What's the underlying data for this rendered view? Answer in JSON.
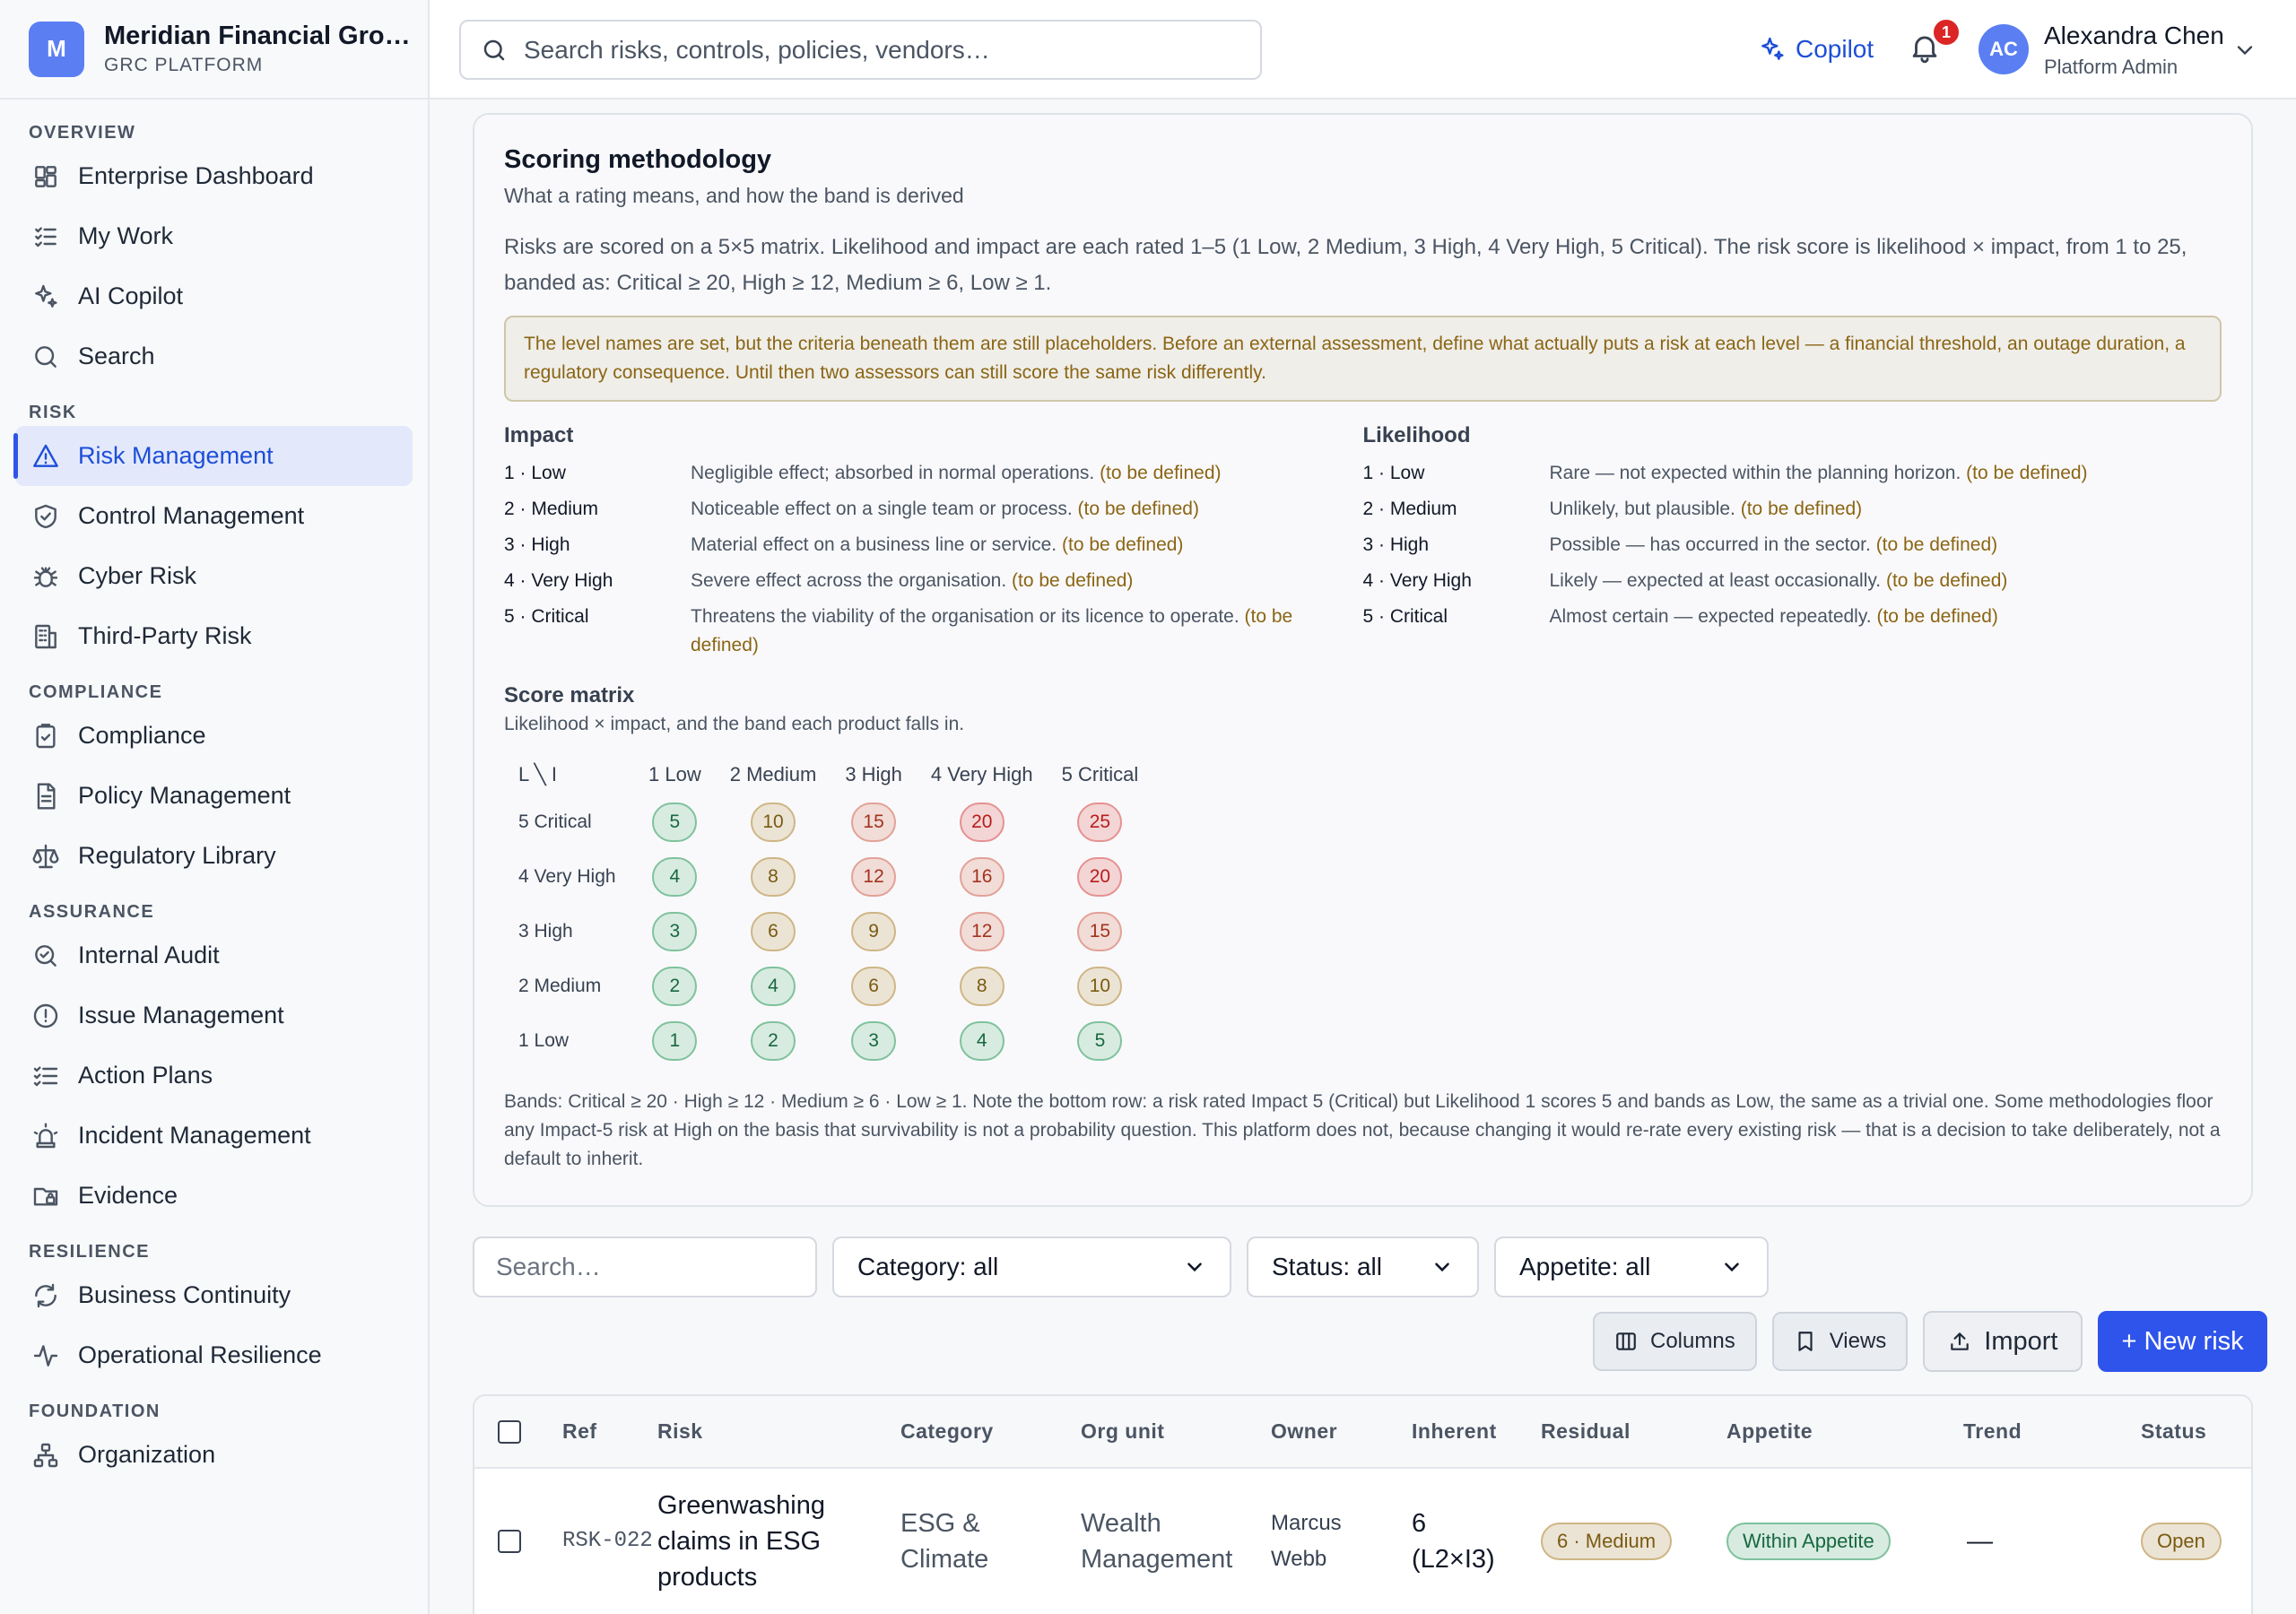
{
  "brand": {
    "logo": "M",
    "name": "Meridian Financial Gro…",
    "subtitle": "GRC PLATFORM"
  },
  "sidebar": {
    "sections": [
      {
        "title": "OVERVIEW",
        "items": [
          {
            "label": "Enterprise Dashboard",
            "icon": "dashboard-icon"
          },
          {
            "label": "My Work",
            "icon": "checklist-icon"
          },
          {
            "label": "AI Copilot",
            "icon": "sparkles-icon"
          },
          {
            "label": "Search",
            "icon": "search-icon"
          }
        ]
      },
      {
        "title": "RISK",
        "items": [
          {
            "label": "Risk Management",
            "icon": "warning-triangle-icon",
            "active": true
          },
          {
            "label": "Control Management",
            "icon": "shield-check-icon"
          },
          {
            "label": "Cyber Risk",
            "icon": "bug-icon"
          },
          {
            "label": "Third-Party Risk",
            "icon": "building-icon"
          }
        ]
      },
      {
        "title": "COMPLIANCE",
        "items": [
          {
            "label": "Compliance",
            "icon": "clipboard-check-icon"
          },
          {
            "label": "Policy Management",
            "icon": "document-icon"
          },
          {
            "label": "Regulatory Library",
            "icon": "scales-icon"
          }
        ]
      },
      {
        "title": "ASSURANCE",
        "items": [
          {
            "label": "Internal Audit",
            "icon": "magnify-check-icon"
          },
          {
            "label": "Issue Management",
            "icon": "alert-circle-icon"
          },
          {
            "label": "Action Plans",
            "icon": "list-check-icon"
          },
          {
            "label": "Incident Management",
            "icon": "siren-icon"
          },
          {
            "label": "Evidence",
            "icon": "folder-lock-icon"
          }
        ]
      },
      {
        "title": "RESILIENCE",
        "items": [
          {
            "label": "Business Continuity",
            "icon": "refresh-icon"
          },
          {
            "label": "Operational Resilience",
            "icon": "activity-icon"
          }
        ]
      },
      {
        "title": "FOUNDATION",
        "items": [
          {
            "label": "Organization",
            "icon": "org-chart-icon"
          }
        ]
      }
    ]
  },
  "topbar": {
    "search_placeholder": "Search risks, controls, policies, vendors…",
    "copilot_label": "Copilot",
    "notification_count": "1",
    "user": {
      "initials": "AC",
      "name": "Alexandra Chen",
      "role": "Platform Admin"
    }
  },
  "methodology": {
    "title": "Scoring methodology",
    "subtitle": "What a rating means, and how the band is derived",
    "body": "Risks are scored on a 5×5 matrix. Likelihood and impact are each rated 1–5 (1 Low, 2 Medium, 3 High, 4 Very High, 5 Critical). The risk score is likelihood × impact, from 1 to 25, banded as: Critical ≥ 20, High ≥ 12, Medium ≥ 6, Low ≥ 1.",
    "notice": "The level names are set, but the criteria beneath them are still placeholders. Before an external assessment, define what actually puts a risk at each level — a financial threshold, an outage duration, a regulatory consequence. Until then two assessors can still score the same risk differently.",
    "tbd_label": "(to be defined)",
    "impact": {
      "title": "Impact",
      "levels": [
        {
          "key": "1 · Low",
          "desc": "Negligible effect; absorbed in normal operations."
        },
        {
          "key": "2 · Medium",
          "desc": "Noticeable effect on a single team or process."
        },
        {
          "key": "3 · High",
          "desc": "Material effect on a business line or service."
        },
        {
          "key": "4 · Very High",
          "desc": "Severe effect across the organisation."
        },
        {
          "key": "5 · Critical",
          "desc": "Threatens the viability of the organisation or its licence to operate."
        }
      ]
    },
    "likelihood": {
      "title": "Likelihood",
      "levels": [
        {
          "key": "1 · Low",
          "desc": "Rare — not expected within the planning horizon."
        },
        {
          "key": "2 · Medium",
          "desc": "Unlikely, but plausible."
        },
        {
          "key": "3 · High",
          "desc": "Possible — has occurred in the sector."
        },
        {
          "key": "4 · Very High",
          "desc": "Likely — expected at least occasionally."
        },
        {
          "key": "5 · Critical",
          "desc": "Almost certain — expected repeatedly."
        }
      ]
    },
    "matrix": {
      "title": "Score matrix",
      "subtitle": "Likelihood × impact, and the band each product falls in.",
      "corner": "L ╲ I",
      "columns": [
        "1 Low",
        "2 Medium",
        "3 High",
        "4 Very High",
        "5 Critical"
      ],
      "rows": [
        {
          "label": "5 Critical",
          "values": [
            5,
            10,
            15,
            20,
            25
          ]
        },
        {
          "label": "4 Very High",
          "values": [
            4,
            8,
            12,
            16,
            20
          ]
        },
        {
          "label": "3 High",
          "values": [
            3,
            6,
            9,
            12,
            15
          ]
        },
        {
          "label": "2 Medium",
          "values": [
            2,
            4,
            6,
            8,
            10
          ]
        },
        {
          "label": "1 Low",
          "values": [
            1,
            2,
            3,
            4,
            5
          ]
        }
      ]
    },
    "bands_note": "Bands: Critical ≥ 20 · High ≥ 12 · Medium ≥ 6 · Low ≥ 1. Note the bottom row: a risk rated Impact 5 (Critical) but Likelihood 1 scores 5 and bands as Low, the same as a trivial one. Some methodologies floor any Impact-5 risk at High on the basis that survivability is not a probability question. This platform does not, because changing it would re-rate every existing risk — that is a decision to take deliberately, not a default to inherit."
  },
  "filters": {
    "search_placeholder": "Search…",
    "category": "Category: all",
    "status": "Status: all",
    "appetite": "Appetite: all"
  },
  "actions": {
    "columns": "Columns",
    "views": "Views",
    "import": "Import",
    "new_risk": "+ New risk"
  },
  "table": {
    "headers": {
      "ref": "Ref",
      "risk": "Risk",
      "category": "Category",
      "org_unit": "Org unit",
      "owner": "Owner",
      "inherent": "Inherent",
      "residual": "Residual",
      "appetite": "Appetite",
      "trend": "Trend",
      "status": "Status"
    },
    "rows": [
      {
        "ref": "RSK-022",
        "risk": "Greenwashing claims in ESG products",
        "category": "ESG & Climate",
        "org_unit": "Wealth Management",
        "owner": "Marcus Webb",
        "inherent": "6 (L2×I3)",
        "residual": "6 · Medium",
        "appetite": "Within Appetite",
        "trend": "—",
        "status": "Open"
      }
    ]
  },
  "colors": {
    "accent": "#2f54eb",
    "low": "#17683e",
    "medium": "#7a5a12",
    "high": "#a3331e",
    "critical": "#b91c1c"
  }
}
